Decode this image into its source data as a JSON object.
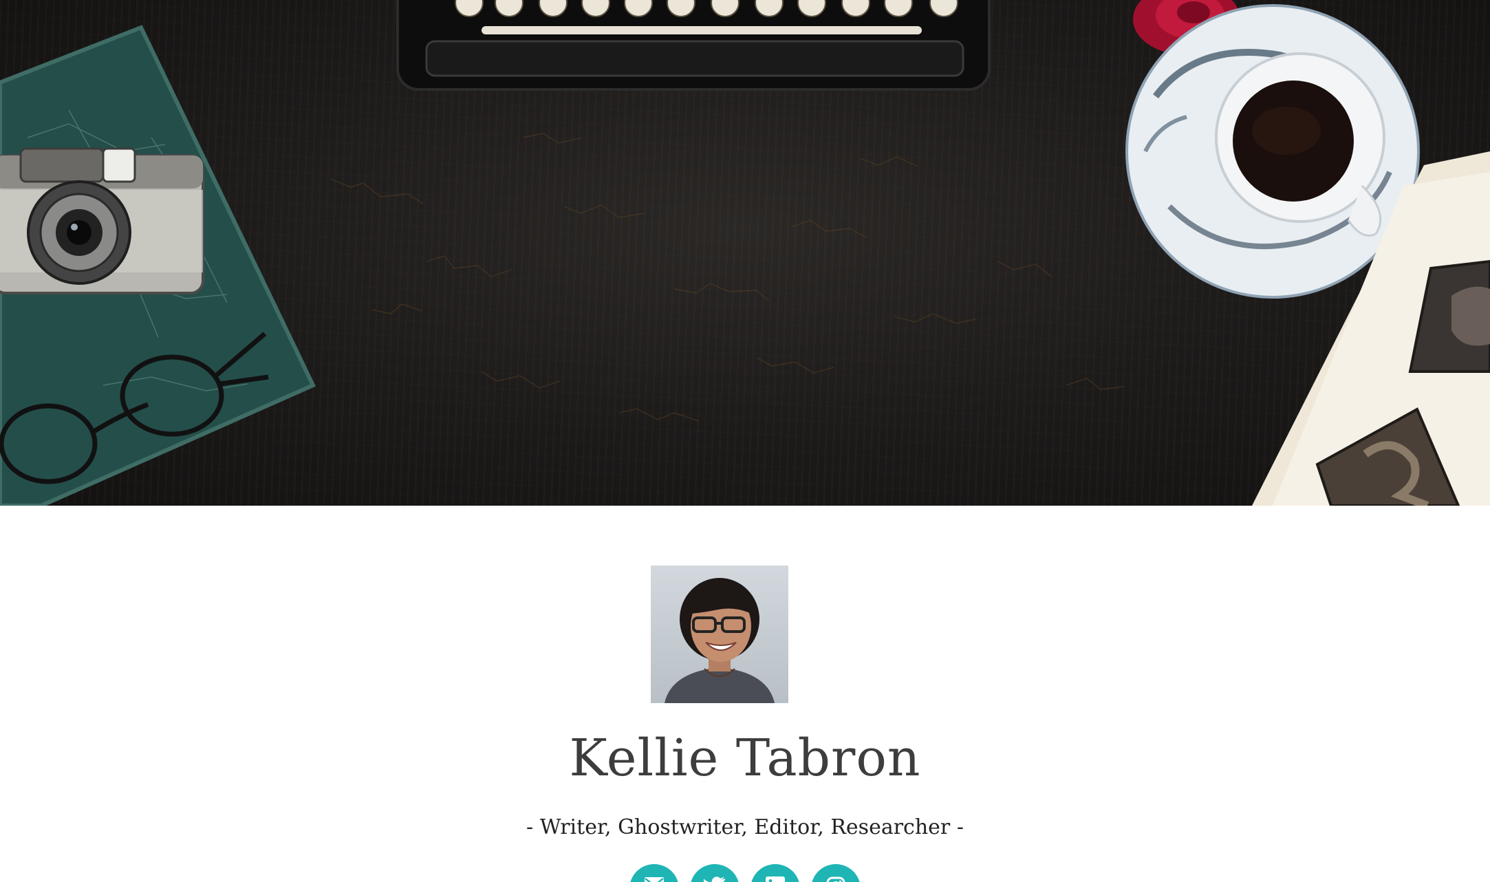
{
  "profile": {
    "name": "Kellie Tabron",
    "tagline": "- Writer, Ghostwriter, Editor, Researcher -"
  },
  "hero": {
    "icons": [
      "typewriter-icon",
      "camera-icon",
      "notebook-icon",
      "glasses-icon",
      "coffee-cup-icon",
      "rose-icon",
      "letterpress-block-icon"
    ]
  },
  "social": {
    "links": [
      {
        "icon": "email-icon"
      },
      {
        "icon": "twitter-icon"
      },
      {
        "icon": "linkedin-icon"
      },
      {
        "icon": "instagram-icon"
      }
    ]
  },
  "colors": {
    "accent": "#1fb5b5",
    "text": "#3d3d3d",
    "hero_background": "#1c1a19"
  }
}
